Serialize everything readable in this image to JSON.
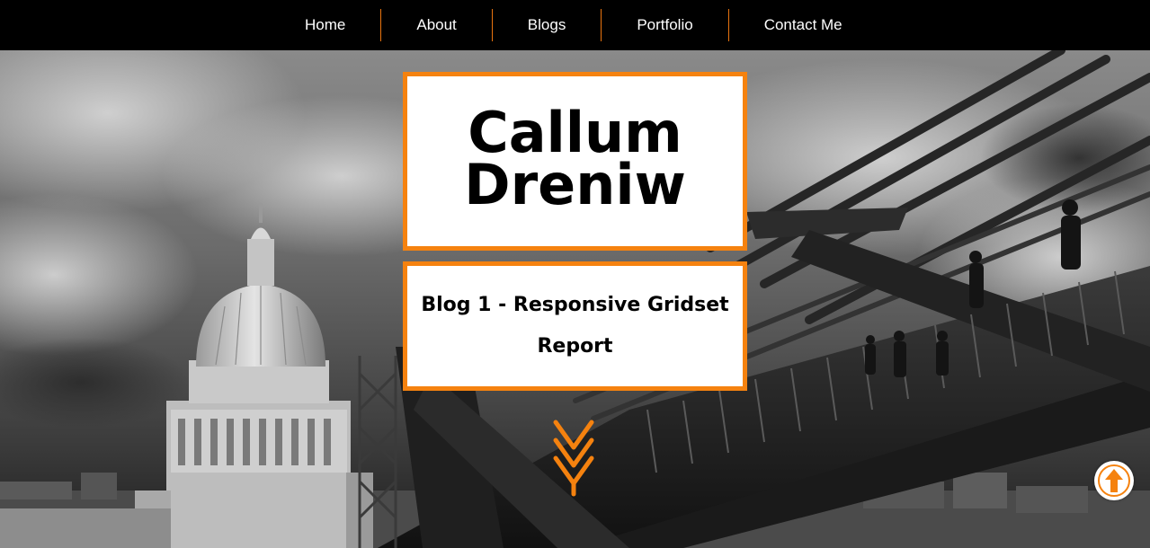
{
  "nav": {
    "items": [
      {
        "label": "Home"
      },
      {
        "label": "About"
      },
      {
        "label": "Blogs"
      },
      {
        "label": "Portfolio"
      },
      {
        "label": "Contact Me"
      }
    ]
  },
  "hero": {
    "title_line1": "Callum",
    "title_line2": "Dreniw",
    "subtitle": "Blog 1 - Responsive Gridset Report",
    "background_image": "black-and-white photo of St Paul's Cathedral and the Millennium Bridge"
  },
  "icons": {
    "scroll_down": "triple-chevron-down-icon",
    "back_to_top": "arrow-up-icon"
  },
  "colors": {
    "accent": "#f5820f",
    "nav_background": "#000000",
    "box_background": "#ffffff"
  }
}
